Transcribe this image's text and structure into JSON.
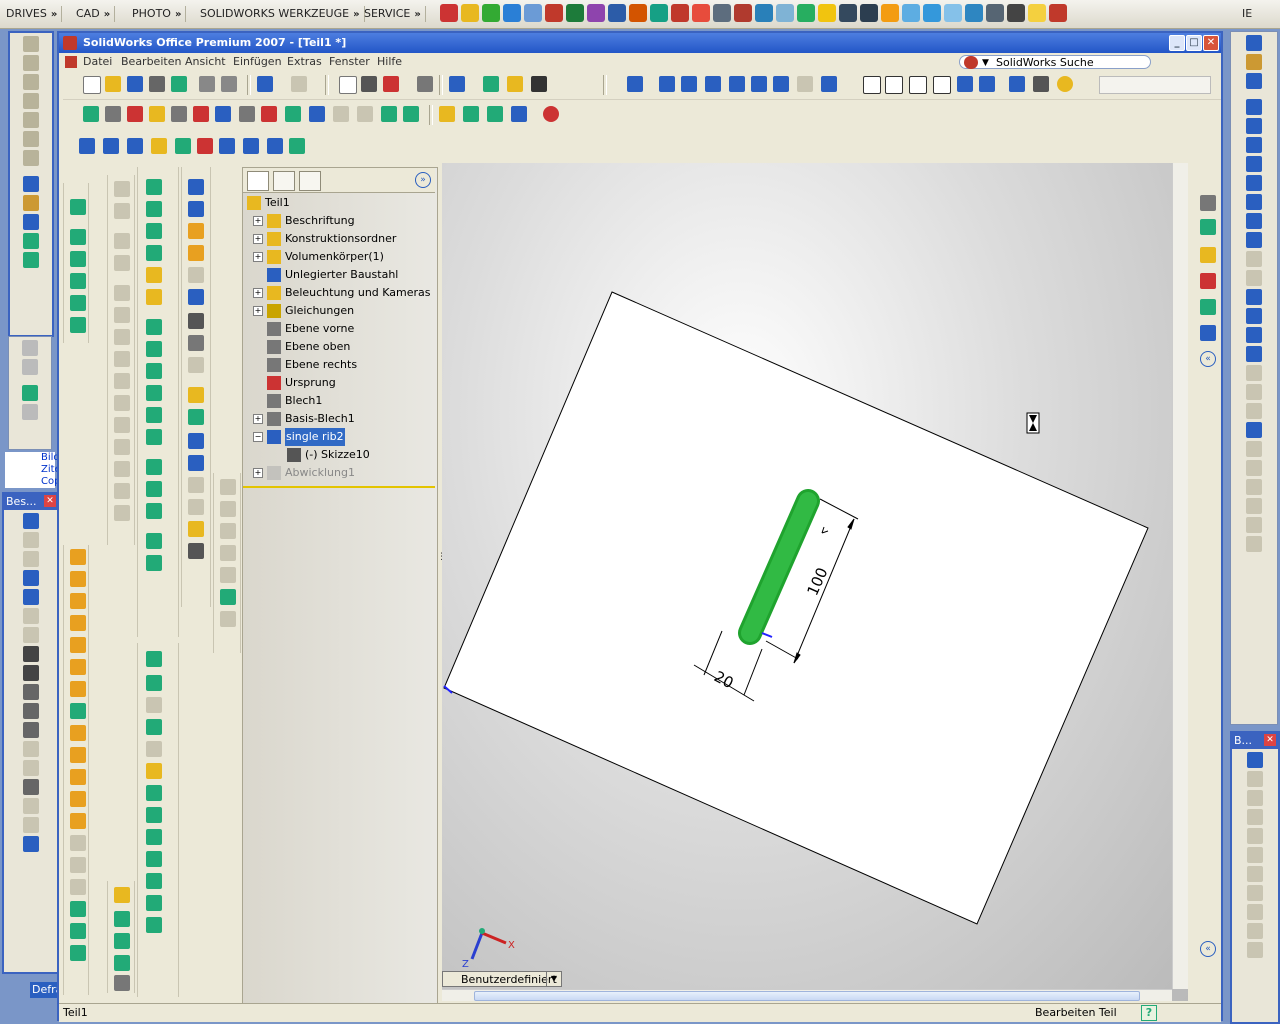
{
  "taskbar": {
    "items": [
      {
        "label": "DRIVES"
      },
      {
        "label": "CAD"
      },
      {
        "label": "PHOTO"
      },
      {
        "label": "SOLIDWORKS WERKZEUGE"
      },
      {
        "label": "SERVICE"
      }
    ],
    "chevron": "»",
    "right_label": "IE"
  },
  "window": {
    "title": "SolidWorks Office Premium 2007 - [Teil1 *]",
    "menu": [
      "Datei",
      "Bearbeiten",
      "Ansicht",
      "Einfügen",
      "Extras",
      "Fenster",
      "Hilfe"
    ],
    "search_label": "SolidWorks Suche"
  },
  "left_panels": {
    "panel_a_text": [
      "Bild",
      "Zite",
      "Cop"
    ],
    "panel_b_title": "Bes...",
    "defrag_label": "Defra"
  },
  "right_panel": {
    "title": "B..."
  },
  "feature_tree": {
    "nodes": [
      {
        "label": "Teil1",
        "icon": "part-icon",
        "expand": "",
        "level": 0
      },
      {
        "label": "Beschriftung",
        "icon": "annotation-icon",
        "expand": "+",
        "level": 1
      },
      {
        "label": "Konstruktionsordner",
        "icon": "folder-icon",
        "expand": "+",
        "level": 1
      },
      {
        "label": "Volumenkörper(1)",
        "icon": "solid-bodies-icon",
        "expand": "+",
        "level": 1
      },
      {
        "label": "Unlegierter Baustahl",
        "icon": "material-icon",
        "expand": "",
        "level": 1
      },
      {
        "label": "Beleuchtung und Kameras",
        "icon": "lights-icon",
        "expand": "+",
        "level": 1
      },
      {
        "label": "Gleichungen",
        "icon": "equations-icon",
        "expand": "+",
        "level": 1
      },
      {
        "label": "Ebene vorne",
        "icon": "plane-icon",
        "expand": "",
        "level": 1
      },
      {
        "label": "Ebene oben",
        "icon": "plane-icon",
        "expand": "",
        "level": 1
      },
      {
        "label": "Ebene rechts",
        "icon": "plane-icon",
        "expand": "",
        "level": 1
      },
      {
        "label": "Ursprung",
        "icon": "origin-icon",
        "expand": "",
        "level": 1
      },
      {
        "label": "Blech1",
        "icon": "sheetmetal-icon",
        "expand": "",
        "level": 1
      },
      {
        "label": "Basis-Blech1",
        "icon": "base-flange-icon",
        "expand": "+",
        "level": 1
      },
      {
        "label": "single rib2",
        "icon": "rib-feature-icon",
        "expand": "−",
        "level": 1,
        "selected": true
      },
      {
        "label": "(-) Skizze10",
        "icon": "sketch-icon",
        "expand": "",
        "level": 2
      },
      {
        "label": "Abwicklung1",
        "icon": "flatten-icon",
        "expand": "+",
        "level": 1,
        "suppressed": true
      }
    ]
  },
  "viewport": {
    "dimension_length": "100",
    "dimension_width": "20",
    "view_orientation": "Benutzerdefiniert",
    "axis_x": "X",
    "axis_z": "Z",
    "rib_color": "#1fa32e"
  },
  "status": {
    "left": "Teil1",
    "right": "Bearbeiten Teil",
    "help": "?"
  }
}
